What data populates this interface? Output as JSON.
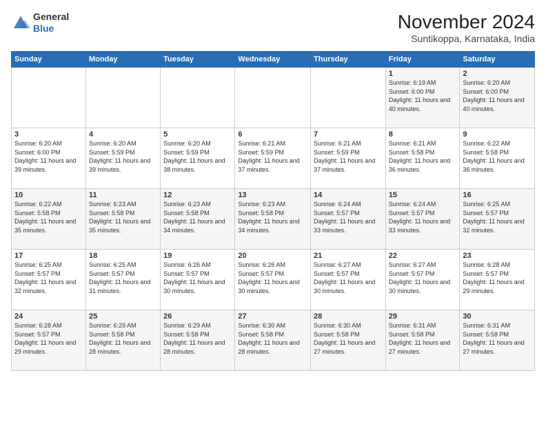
{
  "logo": {
    "general": "General",
    "blue": "Blue"
  },
  "title": "November 2024",
  "subtitle": "Suntikoppa, Karnataka, India",
  "weekdays": [
    "Sunday",
    "Monday",
    "Tuesday",
    "Wednesday",
    "Thursday",
    "Friday",
    "Saturday"
  ],
  "weeks": [
    [
      {
        "day": "",
        "info": ""
      },
      {
        "day": "",
        "info": ""
      },
      {
        "day": "",
        "info": ""
      },
      {
        "day": "",
        "info": ""
      },
      {
        "day": "",
        "info": ""
      },
      {
        "day": "1",
        "info": "Sunrise: 6:19 AM\nSunset: 6:00 PM\nDaylight: 11 hours\nand 40 minutes."
      },
      {
        "day": "2",
        "info": "Sunrise: 6:20 AM\nSunset: 6:00 PM\nDaylight: 11 hours\nand 40 minutes."
      }
    ],
    [
      {
        "day": "3",
        "info": "Sunrise: 6:20 AM\nSunset: 6:00 PM\nDaylight: 11 hours\nand 39 minutes."
      },
      {
        "day": "4",
        "info": "Sunrise: 6:20 AM\nSunset: 5:59 PM\nDaylight: 11 hours\nand 39 minutes."
      },
      {
        "day": "5",
        "info": "Sunrise: 6:20 AM\nSunset: 5:59 PM\nDaylight: 11 hours\nand 38 minutes."
      },
      {
        "day": "6",
        "info": "Sunrise: 6:21 AM\nSunset: 5:59 PM\nDaylight: 11 hours\nand 37 minutes."
      },
      {
        "day": "7",
        "info": "Sunrise: 6:21 AM\nSunset: 5:59 PM\nDaylight: 11 hours\nand 37 minutes."
      },
      {
        "day": "8",
        "info": "Sunrise: 6:21 AM\nSunset: 5:58 PM\nDaylight: 11 hours\nand 36 minutes."
      },
      {
        "day": "9",
        "info": "Sunrise: 6:22 AM\nSunset: 5:58 PM\nDaylight: 11 hours\nand 36 minutes."
      }
    ],
    [
      {
        "day": "10",
        "info": "Sunrise: 6:22 AM\nSunset: 5:58 PM\nDaylight: 11 hours\nand 35 minutes."
      },
      {
        "day": "11",
        "info": "Sunrise: 6:23 AM\nSunset: 5:58 PM\nDaylight: 11 hours\nand 35 minutes."
      },
      {
        "day": "12",
        "info": "Sunrise: 6:23 AM\nSunset: 5:58 PM\nDaylight: 11 hours\nand 34 minutes."
      },
      {
        "day": "13",
        "info": "Sunrise: 6:23 AM\nSunset: 5:58 PM\nDaylight: 11 hours\nand 34 minutes."
      },
      {
        "day": "14",
        "info": "Sunrise: 6:24 AM\nSunset: 5:57 PM\nDaylight: 11 hours\nand 33 minutes."
      },
      {
        "day": "15",
        "info": "Sunrise: 6:24 AM\nSunset: 5:57 PM\nDaylight: 11 hours\nand 33 minutes."
      },
      {
        "day": "16",
        "info": "Sunrise: 6:25 AM\nSunset: 5:57 PM\nDaylight: 11 hours\nand 32 minutes."
      }
    ],
    [
      {
        "day": "17",
        "info": "Sunrise: 6:25 AM\nSunset: 5:57 PM\nDaylight: 11 hours\nand 32 minutes."
      },
      {
        "day": "18",
        "info": "Sunrise: 6:25 AM\nSunset: 5:57 PM\nDaylight: 11 hours\nand 31 minutes."
      },
      {
        "day": "19",
        "info": "Sunrise: 6:26 AM\nSunset: 5:57 PM\nDaylight: 11 hours\nand 30 minutes."
      },
      {
        "day": "20",
        "info": "Sunrise: 6:26 AM\nSunset: 5:57 PM\nDaylight: 11 hours\nand 30 minutes."
      },
      {
        "day": "21",
        "info": "Sunrise: 6:27 AM\nSunset: 5:57 PM\nDaylight: 11 hours\nand 30 minutes."
      },
      {
        "day": "22",
        "info": "Sunrise: 6:27 AM\nSunset: 5:57 PM\nDaylight: 11 hours\nand 30 minutes."
      },
      {
        "day": "23",
        "info": "Sunrise: 6:28 AM\nSunset: 5:57 PM\nDaylight: 11 hours\nand 29 minutes."
      }
    ],
    [
      {
        "day": "24",
        "info": "Sunrise: 6:28 AM\nSunset: 5:57 PM\nDaylight: 11 hours\nand 29 minutes."
      },
      {
        "day": "25",
        "info": "Sunrise: 6:29 AM\nSunset: 5:58 PM\nDaylight: 11 hours\nand 28 minutes."
      },
      {
        "day": "26",
        "info": "Sunrise: 6:29 AM\nSunset: 5:58 PM\nDaylight: 11 hours\nand 28 minutes."
      },
      {
        "day": "27",
        "info": "Sunrise: 6:30 AM\nSunset: 5:58 PM\nDaylight: 11 hours\nand 28 minutes."
      },
      {
        "day": "28",
        "info": "Sunrise: 6:30 AM\nSunset: 5:58 PM\nDaylight: 11 hours\nand 27 minutes."
      },
      {
        "day": "29",
        "info": "Sunrise: 6:31 AM\nSunset: 5:58 PM\nDaylight: 11 hours\nand 27 minutes."
      },
      {
        "day": "30",
        "info": "Sunrise: 6:31 AM\nSunset: 5:58 PM\nDaylight: 11 hours\nand 27 minutes."
      }
    ]
  ]
}
